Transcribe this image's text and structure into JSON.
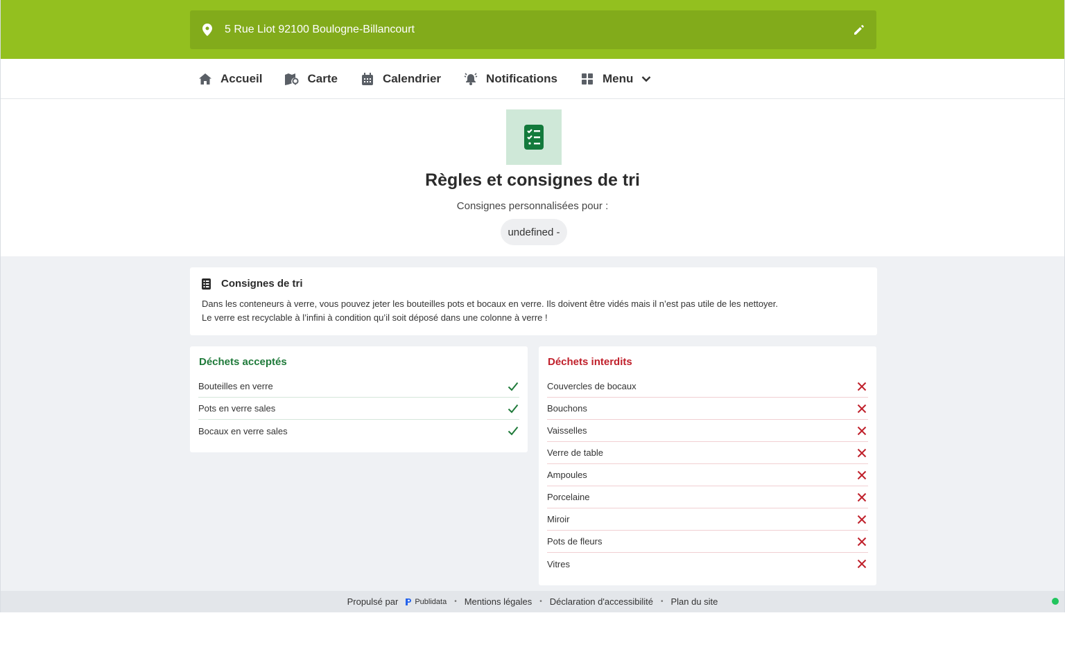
{
  "header": {
    "address": "5 Rue Liot 92100 Boulogne-Billancourt",
    "pin_icon": "map-pin-icon",
    "edit_icon": "pencil-icon",
    "bg_color": "#93c01f"
  },
  "nav": {
    "items": [
      {
        "label": "Accueil",
        "icon": "home-icon"
      },
      {
        "label": "Carte",
        "icon": "map-icon"
      },
      {
        "label": "Calendrier",
        "icon": "calendar-icon"
      },
      {
        "label": "Notifications",
        "icon": "bell-icon"
      },
      {
        "label": "Menu",
        "icon": "grid-icon"
      }
    ]
  },
  "hero": {
    "icon": "checklist-icon",
    "title": "Règles et consignes de tri",
    "subtitle": "Consignes personnalisées pour :",
    "pill": "undefined -"
  },
  "consignes": {
    "title": "Consignes de tri",
    "line1": "Dans les conteneurs à verre, vous pouvez jeter les bouteilles pots et bocaux en verre. Ils doivent être vidés mais il n’est pas utile de les nettoyer.",
    "line2": "Le verre est recyclable à l’infini à condition qu’il soit déposé dans une colonne à verre !"
  },
  "accepted": {
    "title": "Déchets acceptés",
    "color": "#1f7a3a",
    "items": [
      "Bouteilles en verre",
      "Pots en verre sales",
      "Bocaux en verre sales"
    ]
  },
  "forbidden": {
    "title": "Déchets interdits",
    "color": "#c0202b",
    "items": [
      "Couvercles de bocaux",
      "Bouchons",
      "Vaisselles",
      "Verre de table",
      "Ampoules",
      "Porcelaine",
      "Miroir",
      "Pots de fleurs",
      "Vitres"
    ]
  },
  "footer": {
    "powered": "Propulsé par",
    "brand": "Publidata",
    "links": [
      "Mentions légales",
      "Déclaration d'accessibilité",
      "Plan du site"
    ]
  }
}
